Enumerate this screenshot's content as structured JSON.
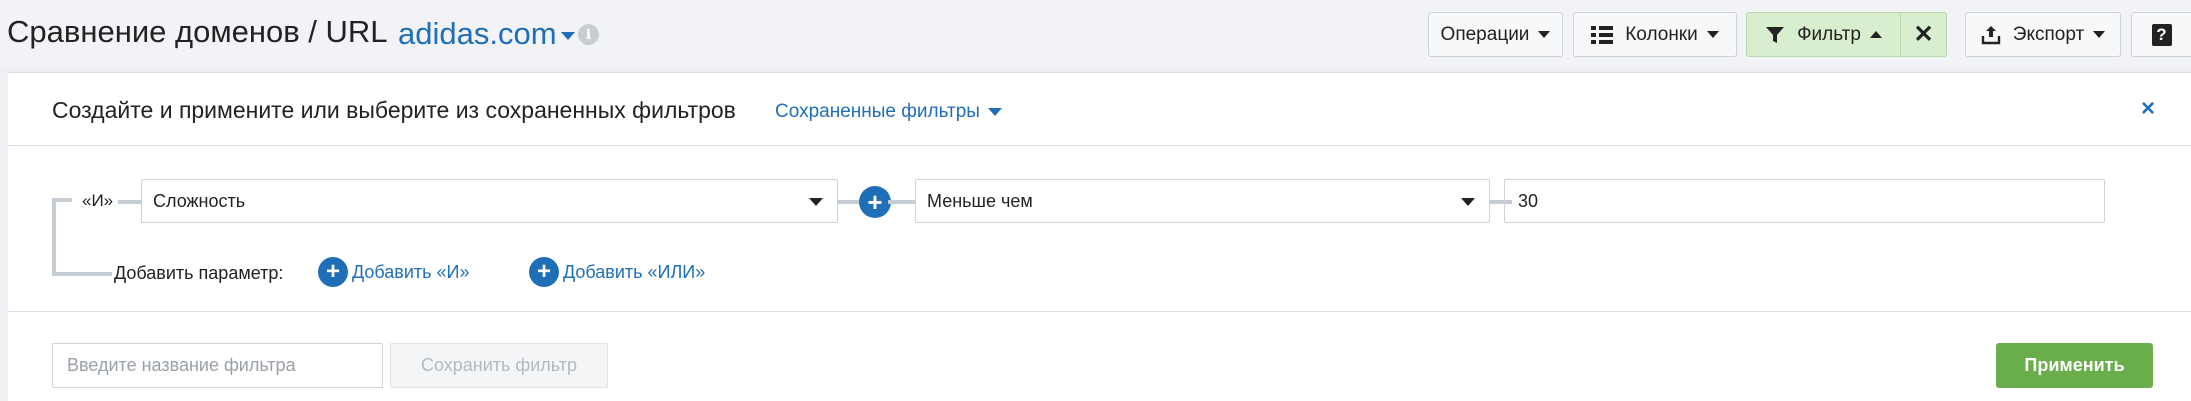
{
  "header": {
    "title": "Сравнение доменов / URL",
    "domain": "adidas.com",
    "info_icon": "info-icon",
    "toolbar": {
      "operations_label": "Операции",
      "columns_label": "Колонки",
      "filter_label": "Фильтр",
      "close_glyph": "✕",
      "export_label": "Экспорт",
      "help_glyph": "?"
    }
  },
  "panel": {
    "title": "Создайте и примените или выберите из сохраненных фильтров",
    "saved_filters_label": "Сохраненные фильтры",
    "close_glyph": "×",
    "condition": {
      "logic_label": "«И»",
      "field": "Сложность",
      "operator": "Меньше чем",
      "value": "30"
    },
    "add_param_label": "Добавить параметр:",
    "add_and_label": "Добавить «И»",
    "add_or_label": "Добавить «ИЛИ»",
    "plus_glyph": "+",
    "filter_name_placeholder": "Введите название фильтра",
    "save_filter_label": "Сохранить фильтр",
    "apply_label": "Применить"
  },
  "colors": {
    "accent_blue": "#1f6fb8",
    "apply_green": "#6aae4c",
    "filter_active_bg": "#d9eecf"
  }
}
